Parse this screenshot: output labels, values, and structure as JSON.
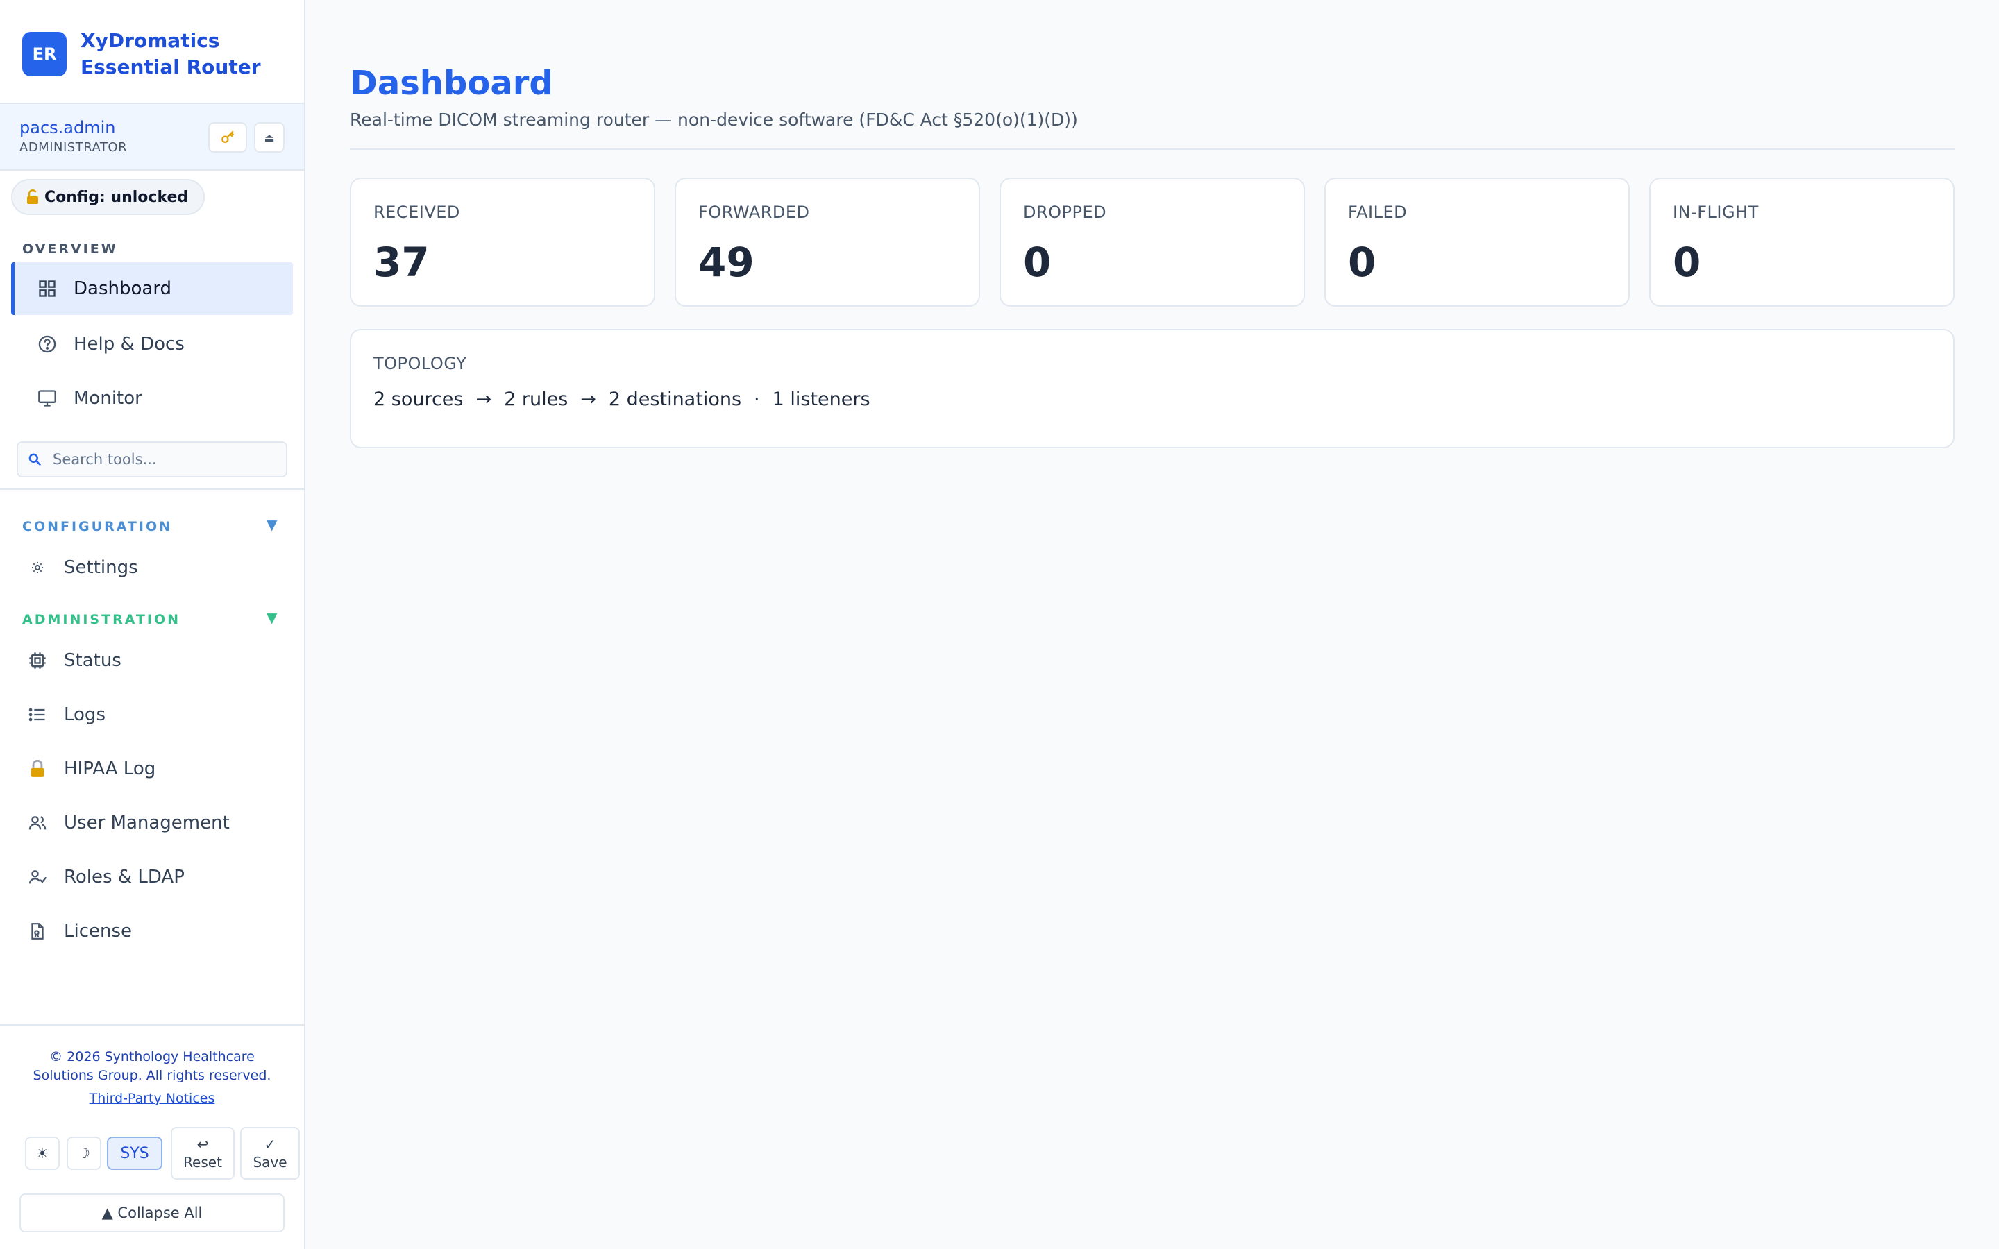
{
  "brand": {
    "logo": "ER",
    "name_line1": "XyDromatics",
    "name_line2": "Essential Router"
  },
  "user": {
    "name": "pacs.admin",
    "role": "ADMINISTRATOR",
    "key_icon": "key-icon",
    "eject_label": "⏏"
  },
  "config_status": {
    "label": "Config: unlocked",
    "icon": "unlock-icon"
  },
  "sidebar": {
    "overview_label": "OVERVIEW",
    "overview_items": [
      {
        "label": "Dashboard",
        "icon": "grid-icon",
        "active": true
      },
      {
        "label": "Help & Docs",
        "icon": "help-circle-icon"
      },
      {
        "label": "Monitor",
        "icon": "monitor-icon"
      }
    ],
    "search_placeholder": "Search tools...",
    "configuration_label": "CONFIGURATION",
    "configuration_toggle": "▼",
    "configuration_items": [
      {
        "label": "Settings",
        "icon": "gear-icon"
      }
    ],
    "administration_label": "ADMINISTRATION",
    "administration_toggle": "▼",
    "administration_items": [
      {
        "label": "Status",
        "icon": "chip-icon"
      },
      {
        "label": "Logs",
        "icon": "list-icon"
      },
      {
        "label": "HIPAA Log",
        "icon": "lock-icon"
      },
      {
        "label": "User Management",
        "icon": "users-icon"
      },
      {
        "label": "Roles & LDAP",
        "icon": "user-check-icon"
      },
      {
        "label": "License",
        "icon": "license-file-icon"
      }
    ]
  },
  "footer": {
    "copyright_line1": "© 2026 Synthology Healthcare",
    "copyright_line2": "Solutions Group. All rights reserved.",
    "notices_link": "Third-Party Notices",
    "theme_light": "☀",
    "theme_dark": "☽",
    "theme_sys": "SYS",
    "reset_icon": "↩",
    "reset_label": "Reset",
    "save_icon": "✓",
    "save_label": "Save",
    "collapse_label": "▲ Collapse All"
  },
  "main": {
    "title": "Dashboard",
    "subtitle": "Real-time DICOM streaming router — non-device software (FD&C Act §520(o)(1)(D))",
    "stats": [
      {
        "label": "RECEIVED",
        "value": "37"
      },
      {
        "label": "FORWARDED",
        "value": "49"
      },
      {
        "label": "DROPPED",
        "value": "0"
      },
      {
        "label": "FAILED",
        "value": "0"
      },
      {
        "label": "IN-FLIGHT",
        "value": "0"
      }
    ],
    "topology": {
      "label": "TOPOLOGY",
      "sources": "2 sources",
      "arrow1": "→",
      "rules": "2 rules",
      "arrow2": "→",
      "destinations": "2 destinations",
      "dot": "·",
      "listeners": "1 listeners"
    }
  },
  "colors": {
    "accent": "#2563eb",
    "configuration_section": "#4a8fd6",
    "administration_section": "#34c08a",
    "lock": "#e0a000"
  }
}
